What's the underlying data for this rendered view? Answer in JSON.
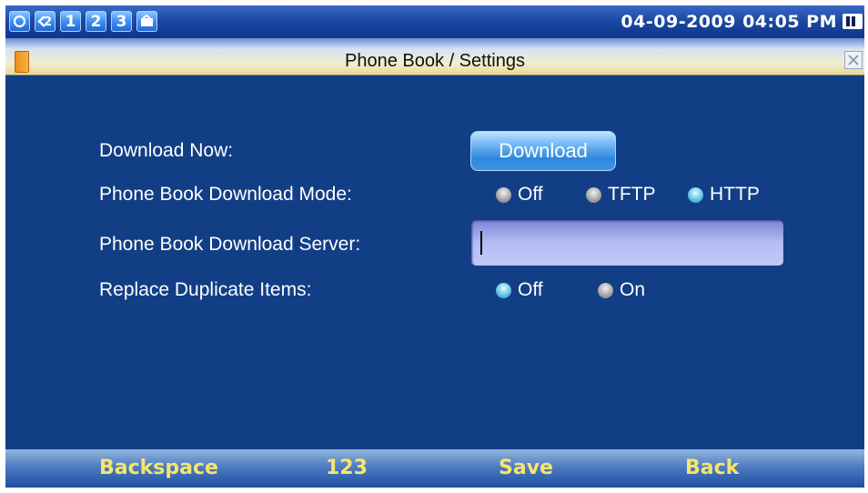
{
  "status_bar": {
    "icons": [
      {
        "name": "refresh-icon",
        "text": ""
      },
      {
        "name": "line2-icon",
        "text": "2"
      },
      {
        "name": "account-1-icon",
        "text": "1"
      },
      {
        "name": "account-2-icon",
        "text": "2"
      },
      {
        "name": "account-3-icon",
        "text": "3"
      },
      {
        "name": "message-icon",
        "text": ""
      }
    ],
    "datetime": "04-09-2009 04:05 PM",
    "battery_icon": "battery-icon"
  },
  "title_bar": {
    "title": "Phone Book / Settings",
    "left_icon": "phonebook-icon",
    "right_icon": "close-icon"
  },
  "form": {
    "download_now": {
      "label": "Download Now:",
      "button_label": "Download"
    },
    "download_mode": {
      "label": "Phone Book Download Mode:",
      "options": [
        {
          "label": "Off",
          "selected": false
        },
        {
          "label": "TFTP",
          "selected": false
        },
        {
          "label": "HTTP",
          "selected": true
        }
      ]
    },
    "download_server": {
      "label": "Phone Book Download Server:",
      "value": ""
    },
    "replace_duplicates": {
      "label": "Replace Duplicate Items:",
      "options": [
        {
          "label": "Off",
          "selected": true
        },
        {
          "label": "On",
          "selected": false
        }
      ]
    }
  },
  "softkeys": {
    "backspace": "Backspace",
    "input_mode": "123",
    "save": "Save",
    "back": "Back"
  },
  "colors": {
    "background": "#123e86",
    "softkey_text": "#f5e66a",
    "selected_radio": "#64c3e8",
    "unselected_radio": "#a8a8a8"
  }
}
